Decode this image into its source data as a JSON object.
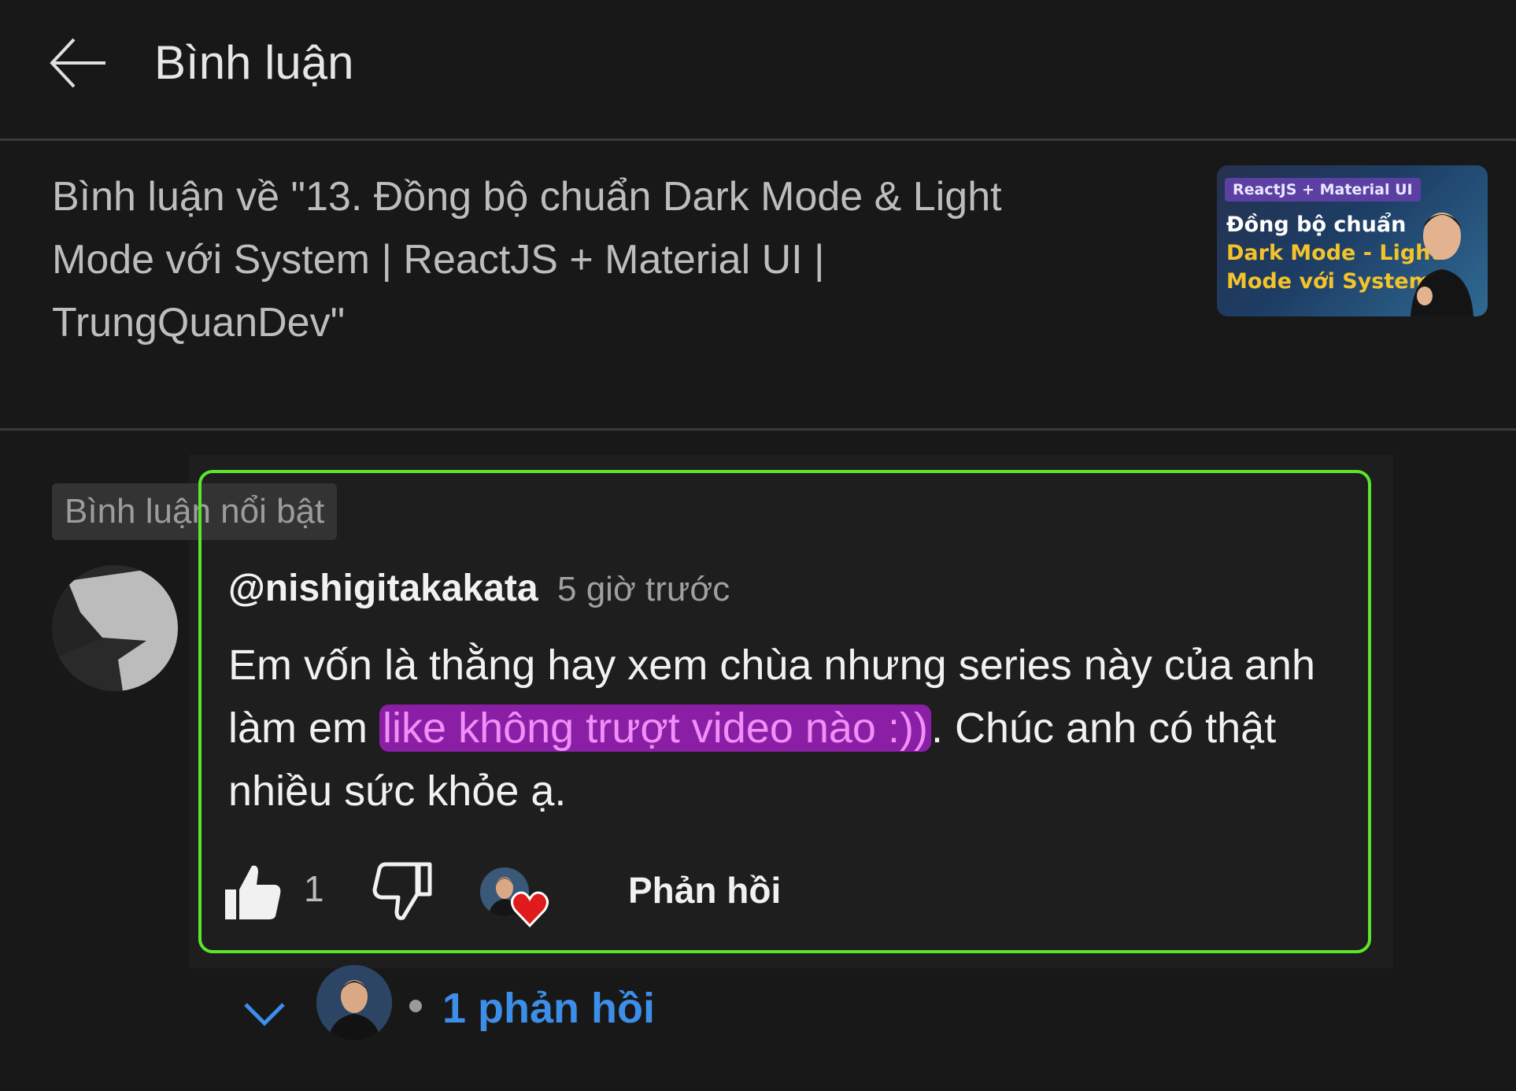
{
  "header": {
    "title": "Bình luận"
  },
  "video": {
    "title": "Bình luận về \"13. Đồng bộ chuẩn Dark Mode & Light Mode với System | ReactJS + Material UI | TrungQuanDev\"",
    "thumbnail": {
      "tag": "ReactJS + Material UI",
      "line1": "Đồng bộ chuẩn",
      "line2": "Dark Mode - Light",
      "line3": "Mode với System"
    }
  },
  "section": {
    "highlight_label": "Bình luận nổi bật"
  },
  "comment": {
    "author": "@nishigitakakata",
    "time": "5 giờ trước",
    "text_before": "Em vốn là thằng hay xem chùa nhưng series này của anh làm em ",
    "text_highlight": "like không trượt video nào :))",
    "text_after": ". Chúc anh có thật nhiều sức khỏe ạ.",
    "like_count": "1",
    "reply_label": "Phản hồi"
  },
  "replies": {
    "label": "1 phản hồi"
  },
  "colors": {
    "background": "#181818",
    "highlight_bg": "#8a1fa6",
    "highlight_text": "#f08ff8",
    "focus_border": "#5ce62a",
    "link": "#3d8ee8",
    "heart": "#e01b1b"
  },
  "icons": [
    "back-arrow-icon",
    "thumbs-up-icon",
    "thumbs-down-icon",
    "heart-icon",
    "chevron-down-icon"
  ]
}
